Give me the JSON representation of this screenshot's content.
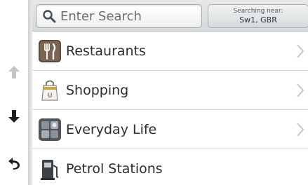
{
  "search": {
    "placeholder": "Enter Search"
  },
  "location": {
    "label": "Searching near:",
    "value": "Sw1, GBR"
  },
  "categories": [
    {
      "label": "Restaurants",
      "icon": "restaurant-icon"
    },
    {
      "label": "Shopping",
      "icon": "shopping-bag-icon"
    },
    {
      "label": "Everyday Life",
      "icon": "everyday-life-icon"
    },
    {
      "label": "Petrol Stations",
      "icon": "petrol-pump-icon"
    }
  ],
  "nav": {
    "up": "arrow-up-icon",
    "down": "arrow-down-icon",
    "back": "back-icon"
  },
  "colors": {
    "text": "#2b2e30",
    "header": "#dfe1e3",
    "divider": "#d3d6d8"
  }
}
